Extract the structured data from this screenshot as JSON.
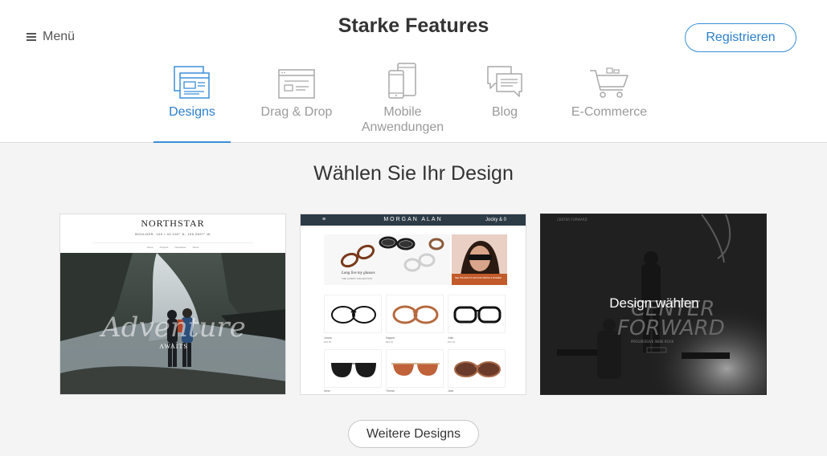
{
  "header": {
    "menu_label": "Menü",
    "title": "Starke Features",
    "register_label": "Registrieren"
  },
  "tabs": [
    {
      "label": "Designs",
      "icon": "designs-icon",
      "active": true
    },
    {
      "label": "Drag & Drop",
      "icon": "drag-drop-icon",
      "active": false
    },
    {
      "label_line1": "Mobile",
      "label_line2": "Anwendungen",
      "icon": "mobile-icon",
      "active": false
    },
    {
      "label": "Blog",
      "icon": "blog-icon",
      "active": false
    },
    {
      "label": "E-Commerce",
      "icon": "cart-icon",
      "active": false
    }
  ],
  "main": {
    "section_title": "Wählen Sie Ihr Design",
    "more_designs_label": "Weitere Designs",
    "templates": [
      {
        "name": "NORTHSTAR",
        "address": "BOULDER, 100 • 40.150° N, 105.2697° W",
        "nav": [
          "Home",
          "Projects",
          "Newsletter",
          "About"
        ],
        "hero_script": "Adventure",
        "hero_sub": "AWAITS"
      },
      {
        "name": "MORGAN ALAN",
        "bar_right": "Jocky & 0",
        "hero_caption": "Long live my glasses",
        "hero_subcaption": "THE LATEST COLLECTION",
        "side_caption": "SEE THE NEW STYLES FOR SPRING & SUMMER",
        "products": [
          {
            "name": "Jonna",
            "price": "$99.00"
          },
          {
            "name": "Dapper",
            "price": "$99.00"
          },
          {
            "name": "Jolie",
            "price": "$99.00"
          },
          {
            "name": "Uma",
            "price": ""
          },
          {
            "name": "Timma",
            "price": ""
          },
          {
            "name": "Jack",
            "price": ""
          }
        ]
      },
      {
        "headline_line1": "CENTER",
        "headline_line2": "FORWARD",
        "tagline": "PROGRESSIVE INDIE ROCK",
        "brand": "CENTER FORWARD",
        "hover_label": "Design wählen"
      }
    ]
  },
  "colors": {
    "accent": "#3a8fd9",
    "accent_text": "#2b7fcc",
    "inactive_tab": "#9a9a9a",
    "background": "#f4f4f4"
  }
}
